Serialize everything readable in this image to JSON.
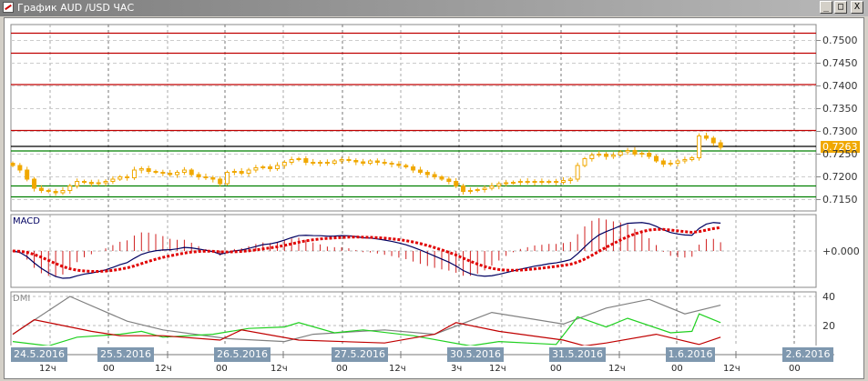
{
  "window": {
    "title": "График AUD /USD  ЧАС",
    "buttons": {
      "minimize": "_",
      "maximize": "□",
      "close": "X"
    }
  },
  "chart_data": [
    {
      "type": "candlestick",
      "title": "График AUD /USD  ЧАС",
      "instrument": "AUD/USD",
      "timeframe": "ЧАС",
      "ylim": [
        0.7125,
        0.7535
      ],
      "y_ticks": [
        "0.7500",
        "0.7450",
        "0.7400",
        "0.7350",
        "0.7300",
        "0.7250",
        "0.7200",
        "0.7150"
      ],
      "y_tick_values": [
        0.75,
        0.745,
        0.74,
        0.735,
        0.73,
        0.725,
        0.72,
        0.715
      ],
      "current_price": "0.7263",
      "levels": [
        {
          "price": 0.7516,
          "color": "#c00000"
        },
        {
          "price": 0.7472,
          "color": "#c00000"
        },
        {
          "price": 0.7403,
          "color": "#c00000"
        },
        {
          "price": 0.7302,
          "color": "#c00000"
        },
        {
          "price": 0.7267,
          "color": "#000000"
        },
        {
          "price": 0.7257,
          "color": "#008000"
        },
        {
          "price": 0.718,
          "color": "#008000"
        },
        {
          "price": 0.7156,
          "color": "#008000"
        }
      ],
      "closes": [
        0.7225,
        0.7215,
        0.7195,
        0.7175,
        0.717,
        0.7168,
        0.7165,
        0.717,
        0.718,
        0.719,
        0.7188,
        0.7185,
        0.7187,
        0.719,
        0.7195,
        0.72,
        0.7198,
        0.7215,
        0.7218,
        0.7212,
        0.721,
        0.7208,
        0.7205,
        0.721,
        0.7215,
        0.7205,
        0.72,
        0.7198,
        0.7195,
        0.7185,
        0.721,
        0.7212,
        0.7208,
        0.7215,
        0.722,
        0.7222,
        0.7218,
        0.7225,
        0.7232,
        0.7238,
        0.724,
        0.7232,
        0.723,
        0.7232,
        0.723,
        0.7235,
        0.7238,
        0.7236,
        0.7233,
        0.723,
        0.7235,
        0.7232,
        0.723,
        0.7228,
        0.7225,
        0.7222,
        0.7215,
        0.721,
        0.7205,
        0.72,
        0.7195,
        0.719,
        0.718,
        0.7168,
        0.717,
        0.7172,
        0.7175,
        0.718,
        0.7185,
        0.7187,
        0.7188,
        0.719,
        0.7188,
        0.719,
        0.7188,
        0.719,
        0.7188,
        0.7192,
        0.7195,
        0.7225,
        0.724,
        0.7248,
        0.725,
        0.7245,
        0.7248,
        0.7255,
        0.7258,
        0.725,
        0.7252,
        0.7245,
        0.7235,
        0.7228,
        0.723,
        0.7235,
        0.7238,
        0.7242,
        0.729,
        0.7285,
        0.7275,
        0.7265
      ],
      "colors": {
        "candle": "#f0a800"
      }
    },
    {
      "type": "line",
      "title": "MACD",
      "y_ticks": [
        "+0.000"
      ],
      "series": [
        {
          "name": "MACD",
          "color": "#000060"
        },
        {
          "name": "Signal",
          "color": "#e00000"
        },
        {
          "name": "Histogram",
          "color": "#d02020"
        }
      ],
      "note": "computed from closes"
    },
    {
      "type": "line",
      "title": "DMI",
      "ylim": [
        0,
        40
      ],
      "y_ticks": [
        "40",
        "20"
      ],
      "y_tick_values": [
        40,
        20
      ],
      "series": [
        {
          "name": "ADX",
          "color": "#808080",
          "points": [
            [
              0,
              14
            ],
            [
              8,
              40
            ],
            [
              16,
              23
            ],
            [
              21,
              17
            ],
            [
              30,
              11
            ],
            [
              38,
              9
            ],
            [
              42,
              14
            ],
            [
              52,
              17
            ],
            [
              59,
              14
            ],
            [
              67,
              29
            ],
            [
              77,
              21
            ],
            [
              83,
              32
            ],
            [
              89,
              38
            ],
            [
              94,
              28
            ],
            [
              99,
              34
            ]
          ]
        },
        {
          "name": "+DI",
          "color": "#20d020",
          "points": [
            [
              0,
              9
            ],
            [
              5,
              6
            ],
            [
              9,
              12
            ],
            [
              15,
              14
            ],
            [
              18,
              16
            ],
            [
              21,
              12
            ],
            [
              28,
              14
            ],
            [
              33,
              18
            ],
            [
              38,
              19
            ],
            [
              40,
              22
            ],
            [
              45,
              15
            ],
            [
              49,
              17
            ],
            [
              56,
              13
            ],
            [
              64,
              6
            ],
            [
              68,
              9
            ],
            [
              76,
              7
            ],
            [
              79,
              26
            ],
            [
              83,
              19
            ],
            [
              86,
              25
            ],
            [
              92,
              15
            ],
            [
              95,
              16
            ],
            [
              96,
              28
            ],
            [
              99,
              22
            ]
          ]
        },
        {
          "name": "-DI",
          "color": "#c00000",
          "points": [
            [
              0,
              14
            ],
            [
              3,
              24
            ],
            [
              6,
              21
            ],
            [
              11,
              16
            ],
            [
              15,
              13
            ],
            [
              21,
              13
            ],
            [
              29,
              10
            ],
            [
              32,
              17
            ],
            [
              40,
              10
            ],
            [
              52,
              8
            ],
            [
              59,
              14
            ],
            [
              62,
              22
            ],
            [
              68,
              16
            ],
            [
              77,
              10
            ],
            [
              80,
              6
            ],
            [
              83,
              8
            ],
            [
              90,
              14
            ],
            [
              96,
              7
            ],
            [
              99,
              12
            ]
          ]
        }
      ]
    }
  ],
  "time_axis": {
    "dates": [
      "24.5.2016",
      "25.5.2016",
      "26.5.2016",
      "27.5.2016",
      "30.5.2016",
      "31.5.2016",
      "1.6.2016",
      "2.6.2016"
    ],
    "hours": [
      "12ч",
      "00",
      "12ч",
      "00",
      "12ч",
      "00",
      "12ч",
      "3ч",
      "12ч",
      "00",
      "12ч",
      "00",
      "12ч",
      "00"
    ]
  }
}
